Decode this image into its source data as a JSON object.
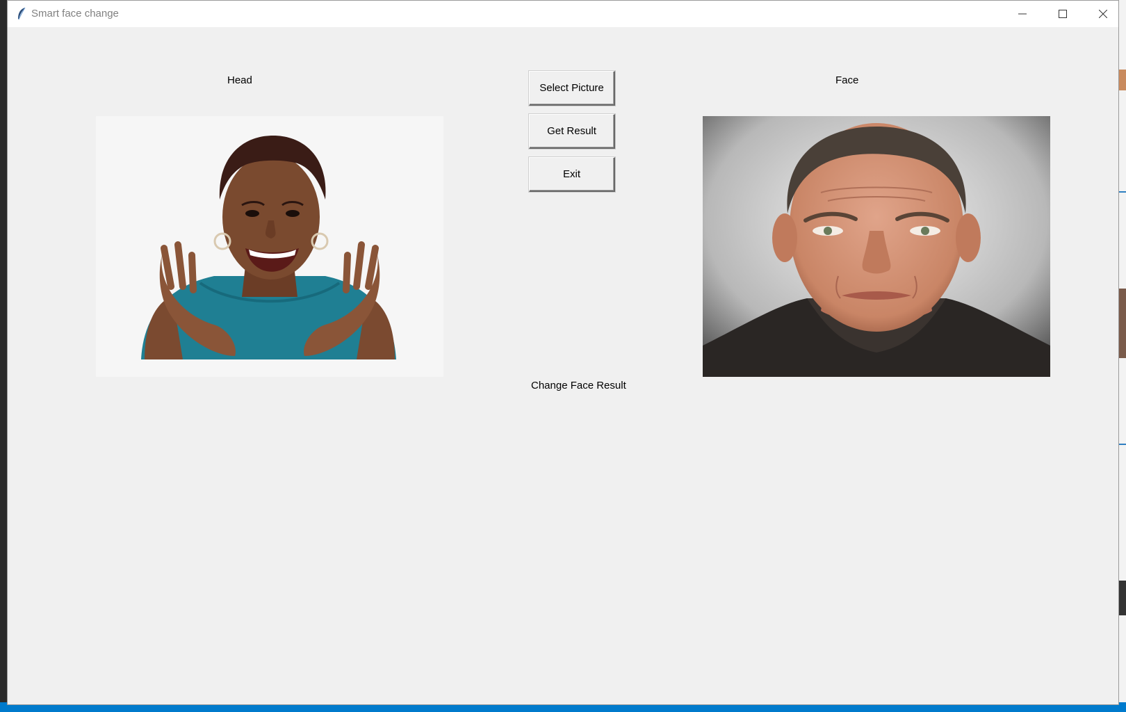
{
  "window": {
    "title": "Smart face change",
    "controls": [
      "minimize-icon",
      "maximize-icon",
      "close-icon"
    ]
  },
  "labels": {
    "head": "Head",
    "face": "Face",
    "result": "Change Face Result"
  },
  "buttons": {
    "select_picture": "Select Picture",
    "get_result": "Get Result",
    "exit": "Exit"
  },
  "images": {
    "head": "photo of a smiling woman with raised hands",
    "face": "front-facing portrait photo of a man"
  },
  "colors": {
    "window_bg": "#f0f0f0",
    "titlebar_bg": "#ffffff",
    "title_text": "#808080",
    "taskbar_status": "#007acc"
  }
}
